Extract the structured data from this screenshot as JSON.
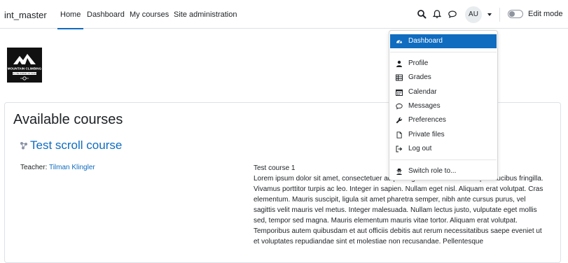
{
  "navbar": {
    "brand": "int_master",
    "links": [
      {
        "label": "Home",
        "active": true
      },
      {
        "label": "Dashboard",
        "active": false
      },
      {
        "label": "My courses",
        "active": false
      },
      {
        "label": "Site administration",
        "active": false
      }
    ],
    "icons": [
      "search-icon",
      "bell-icon",
      "chat-bubble-icon"
    ],
    "avatar_initials": "AU",
    "edit_mode_label": "Edit mode",
    "edit_mode_on": false
  },
  "logo": {
    "title": "MOUNTAIN CLIMBING",
    "subtitle": "ENJOY THE JOURNEY OF YOUR LIFE"
  },
  "main": {
    "heading": "Available courses",
    "course": {
      "title": "Test scroll course",
      "teacher_label": "Teacher: ",
      "teacher_name": "Tilman Klingler",
      "summary_title": "Test course 1",
      "summary_paragraph_1": "Lorem ipsum dolor sit amet, consectetuer adipiscing elit. Nulla lacinia neque faucibus fringilla. Vivamus porttitor turpis ac leo. Integer in sapien. Nullam eget nisl. Aliquam erat volutpat. Cras elementum. Mauris suscipit, ligula sit amet pharetra semper, nibh ante cursus purus, vel sagittis velit mauris vel metus. Integer malesuada. Nullam lectus justo, vulputate eget mollis sed, tempor sed magna. Mauris elementum mauris vitae tortor. Aliquam erat volutpat.",
      "summary_paragraph_2": "Temporibus autem quibusdam et aut officiis debitis aut rerum necessitatibus saepe eveniet ut et voluptates repudiandae sint et molestiae non recusandae. Pellentesque"
    }
  },
  "user_menu": {
    "items": [
      {
        "label": "Dashboard",
        "icon": "dashboard-gauge-icon",
        "active": true
      },
      {
        "label": "Profile",
        "icon": "user-icon",
        "active": false
      },
      {
        "label": "Grades",
        "icon": "table-icon",
        "active": false
      },
      {
        "label": "Calendar",
        "icon": "calendar-icon",
        "active": false
      },
      {
        "label": "Messages",
        "icon": "comment-icon",
        "active": false
      },
      {
        "label": "Preferences",
        "icon": "wrench-icon",
        "active": false
      },
      {
        "label": "Private files",
        "icon": "file-icon",
        "active": false
      },
      {
        "label": "Log out",
        "icon": "sign-out-icon",
        "active": false
      },
      {
        "label": "Switch role to...",
        "icon": "user-secret-icon",
        "active": false
      }
    ]
  },
  "colors": {
    "accent": "#0f6cbf",
    "text": "#1d2125",
    "border": "#dee2e6"
  }
}
